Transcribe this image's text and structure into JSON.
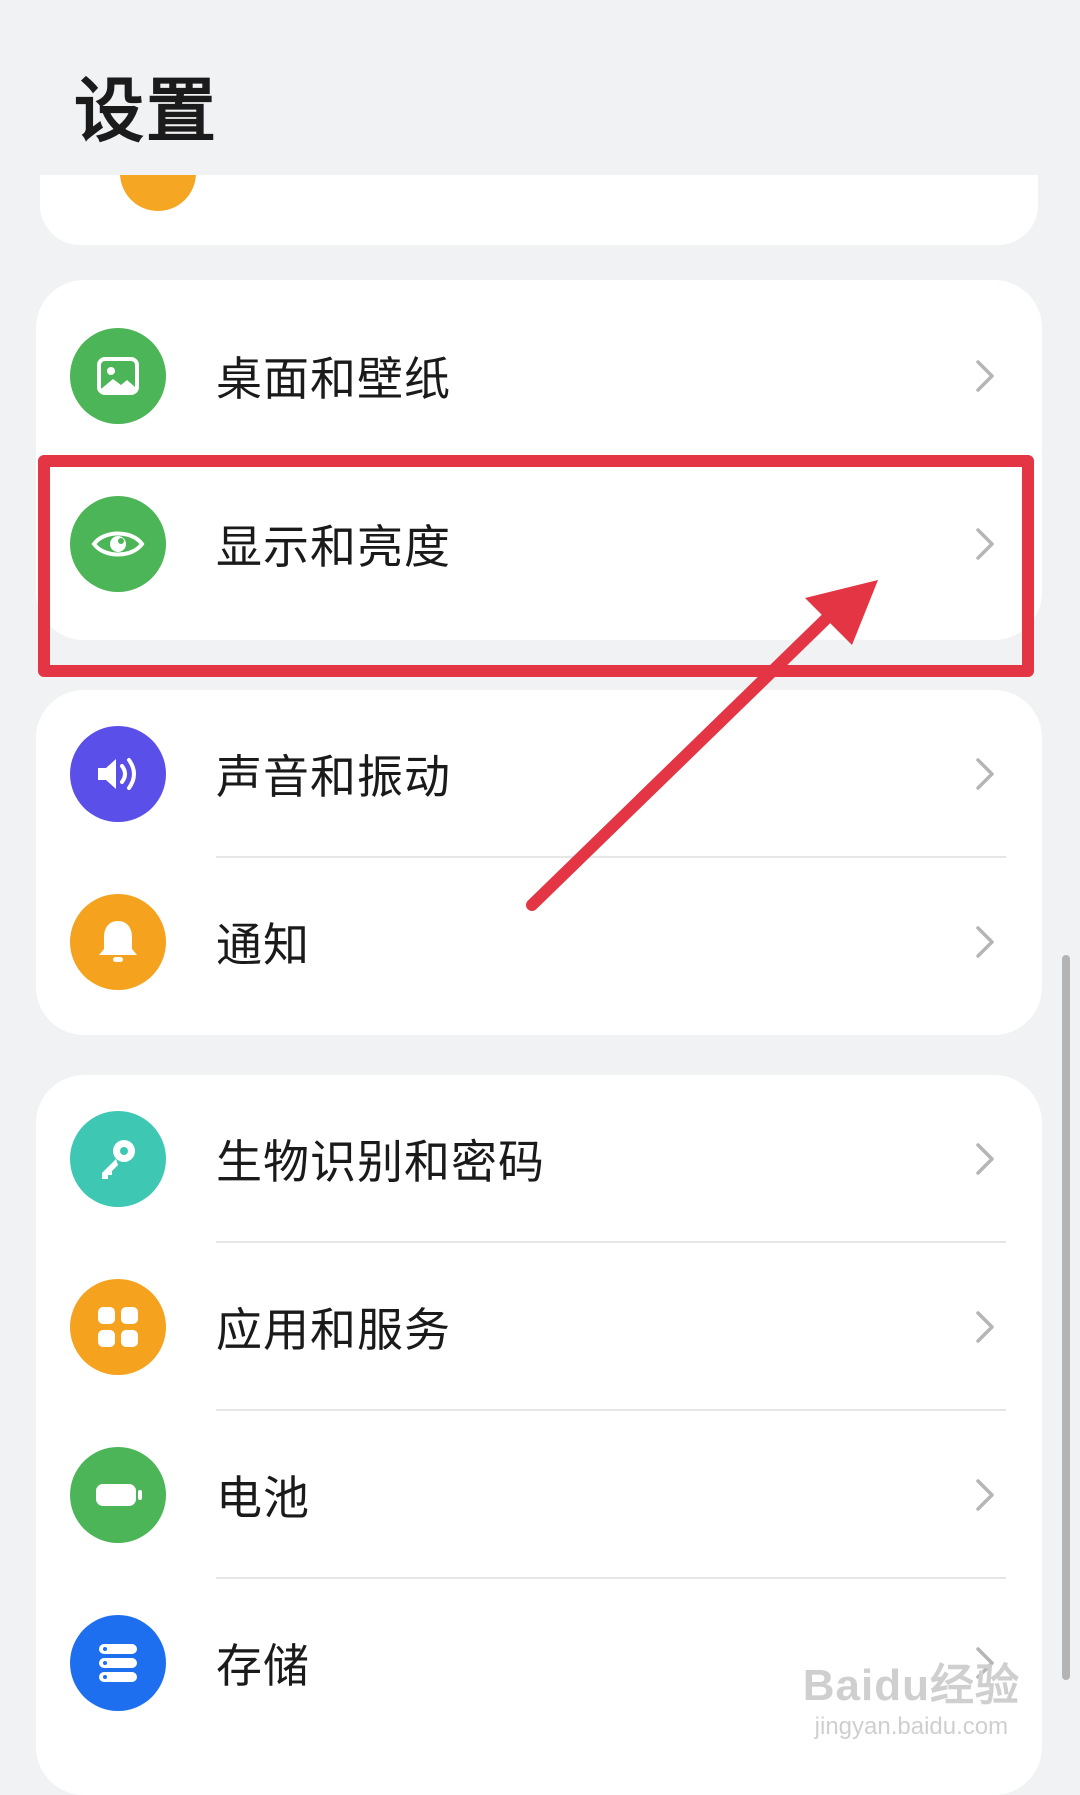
{
  "header": {
    "title": "设置"
  },
  "cards": [
    {
      "items": [
        {
          "label": "桌面和壁纸",
          "icon": "wallpaper-icon",
          "color": "#4cb557"
        },
        {
          "label": "显示和亮度",
          "icon": "eye-icon",
          "color": "#4cb557"
        }
      ]
    },
    {
      "items": [
        {
          "label": "声音和振动",
          "icon": "speaker-icon",
          "color": "#5b4fe9"
        },
        {
          "label": "通知",
          "icon": "bell-icon",
          "color": "#f5a21e"
        }
      ]
    },
    {
      "items": [
        {
          "label": "生物识别和密码",
          "icon": "key-icon",
          "color": "#3ec8b4"
        },
        {
          "label": "应用和服务",
          "icon": "apps-icon",
          "color": "#f5a21e"
        },
        {
          "label": "电池",
          "icon": "battery-icon",
          "color": "#4cb557"
        },
        {
          "label": "存储",
          "icon": "storage-icon",
          "color": "#1e6ff0"
        }
      ]
    }
  ],
  "annotation": {
    "color": "#e43545",
    "highlighted_item": "显示和亮度"
  },
  "watermark": {
    "main": "Baidu经验",
    "sub": "jingyan.baidu.com"
  }
}
